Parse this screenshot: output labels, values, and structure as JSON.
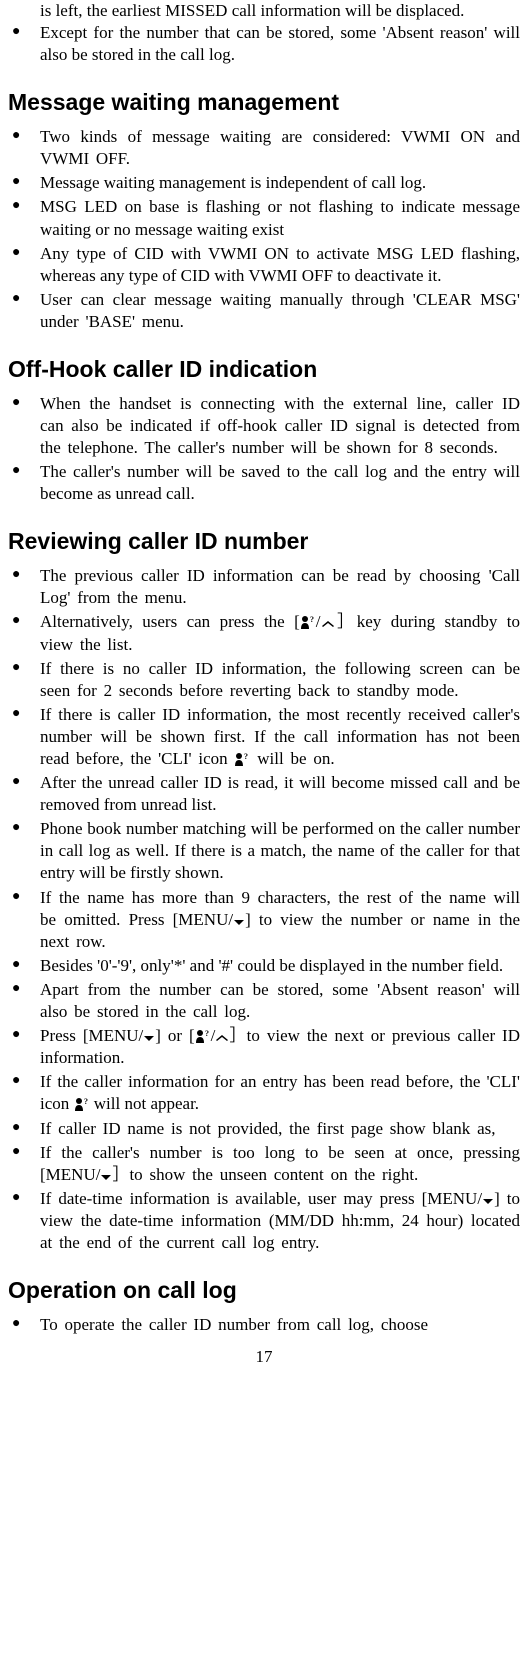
{
  "intro": {
    "cont1": "is left, the earliest MISSED call information will be displaced.",
    "item1": "Except for the number that can be stored, some 'Absent reason' will also be stored in the call log."
  },
  "sections": [
    {
      "heading": "Message waiting management",
      "items": [
        "Two kinds of message waiting are considered: VWMI ON and VWMI OFF.",
        "Message waiting management is independent of call log.",
        "MSG LED on base is flashing or not flashing to indicate message waiting or no message waiting exist",
        "Any type of CID with VWMI ON to activate MSG LED flashing, whereas any type of CID with VWMI OFF to deactivate it.",
        "User can clear message waiting manually through 'CLEAR MSG' under 'BASE' menu."
      ]
    },
    {
      "heading": "Off-Hook caller ID indication",
      "items": [
        "When the handset is connecting with the external line, caller ID can also be indicated if off-hook caller ID signal is detected from the telephone. The caller's number will be shown for 8 seconds.",
        "The caller's number will be saved to the call log and the entry will become as unread call."
      ]
    }
  ],
  "review": {
    "heading": "Reviewing caller ID number",
    "items": {
      "i1": "The previous caller ID information can be read by choosing 'Call Log' from the menu.",
      "i2a": "Alternatively, users can press the [",
      "i2b": "/",
      "i2c": "］key during standby to view the list.",
      "i3": "If there is no caller ID information, the following screen can be seen for 2 seconds before reverting back to standby mode.",
      "i4a": "If there is caller ID information, the most recently received caller's number will be shown first. If the call information has not been read before, the 'CLI' icon ",
      "i4b": " will be on.",
      "i5": "After the unread caller ID is read, it will become missed call and be removed from unread list.",
      "i6": "Phone book number matching will be performed on the caller number in call log as well. If there is a match, the name of the caller for that entry will be firstly shown.",
      "i7a": "If the name has more than 9 characters, the rest of the name will be omitted. Press [MENU/",
      "i7b": "] to view the number or name in the next row.",
      "i8": "Besides '0'-'9', only'*' and '#' could be displayed in the number field.",
      "i9": "Apart from the number can be stored, some 'Absent reason' will also be stored in the call log.",
      "i10a": "Press [MENU/",
      "i10b": "] or [",
      "i10c": "/",
      "i10d": "］to view the next or previous caller ID information.",
      "i11a": "If the caller information for an entry has been read before, the 'CLI' icon ",
      "i11b": " will not appear.",
      "i12": "If caller ID name is not provided, the first page show blank as,",
      "i13a": "If the caller's number is too long to be seen at once, pressing [MENU/",
      "i13b": "］to show the unseen content on the right.",
      "i14a": "If date-time information is available, user may press [MENU/",
      "i14b": "] to view the date-time information (MM/DD hh:mm, 24 hour) located at the end of the current call log entry."
    }
  },
  "operation": {
    "heading": "Operation on call log",
    "items": {
      "i1": "To operate the caller ID number from call log, choose"
    }
  },
  "page_number": "17"
}
